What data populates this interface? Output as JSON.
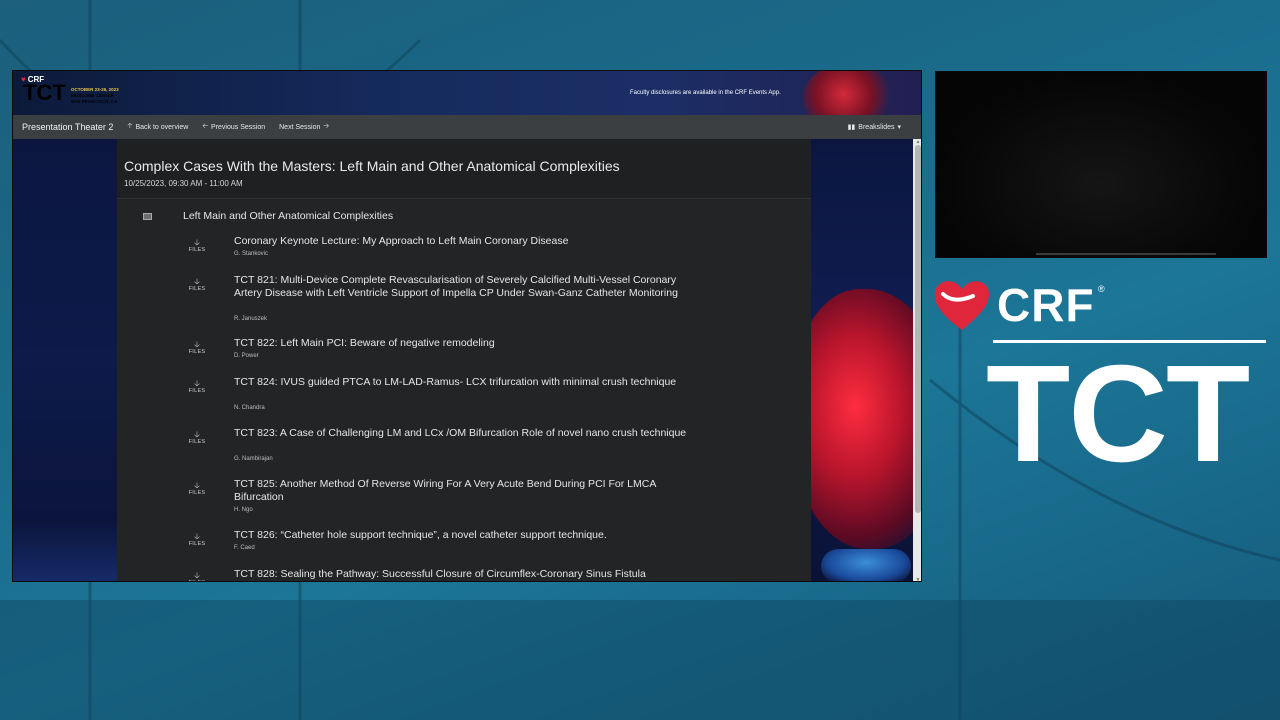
{
  "banner": {
    "crf": "CRF",
    "tct": "TCT",
    "event_date": "OCTOBER 23-26, 2023",
    "event_venue": "MOSCONE CENTER",
    "event_city": "SAN FRANCISCO, CA",
    "disclosure": "Faculty disclosures are available in the CRF Events App."
  },
  "nav": {
    "brand": "Presentation Theater 2",
    "back": "Back to overview",
    "prev": "Previous Session",
    "next": "Next Session",
    "breakslides": "Breakslides"
  },
  "session": {
    "title": "Complex Cases With the Masters: Left Main and Other Anatomical Complexities",
    "date": "10/25/2023, 09:30 AM - 11:00 AM",
    "section": "Left Main and Other Anatomical Complexities"
  },
  "files_label": "FILES",
  "talks": [
    {
      "title": "Coronary Keynote Lecture: My Approach to Left Main Coronary Disease",
      "author": "G. Stankovic"
    },
    {
      "title": "TCT 821: Multi-Device Complete Revascularisation of Severely Calcified Multi-Vessel Coronary Artery Disease with Left Ventricle Support of Impella CP Under  Swan-Ganz Catheter Monitoring",
      "author": "R. Januszek"
    },
    {
      "title": "TCT 822: Left Main PCI: Beware of negative remodeling",
      "author": "D. Power"
    },
    {
      "title": "TCT 824: IVUS guided PTCA to LM-LAD-Ramus- LCX trifurcation with minimal crush technique",
      "author": "N. Chandra"
    },
    {
      "title": "TCT 823: A Case of Challenging LM and LCx /OM Bifurcation Role of novel nano crush technique",
      "author": "G. Nambirajan"
    },
    {
      "title": "TCT 825: Another Method Of Reverse Wiring For A Very Acute Bend During PCI For LMCA Bifurcation",
      "author": "H. Ngo"
    },
    {
      "title": "TCT 826: “Catheter hole support technique”, a novel catheter support technique.",
      "author": "F. Caed"
    },
    {
      "title": "TCT 828: Sealing the Pathway: Successful Closure of Circumflex-Coronary Sinus Fistula",
      "author": ""
    }
  ],
  "brand": {
    "crf": "CRF",
    "reg": "®",
    "tct": "TCT"
  },
  "colors": {
    "background": "#1a6a8a",
    "crf_red": "#e0263a",
    "navbar": "#3c3f42",
    "panel": "#222426"
  }
}
